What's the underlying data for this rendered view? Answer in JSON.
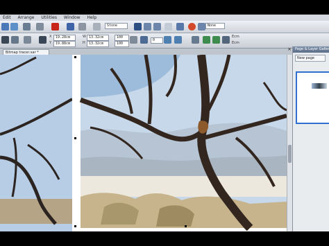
{
  "menu": [
    "Edit",
    "Arrange",
    "Utilities",
    "Window",
    "Help"
  ],
  "toolbar": {
    "zoom_value": "Stone",
    "style_value": "None",
    "x_value": "19.28cm",
    "y_value": "19.88cm",
    "w_value": "13.32cm",
    "h_value": "13.32cm",
    "scale_x": "100",
    "scale_y": "100",
    "rotate_value": "0",
    "text_opt_1": "Ecm",
    "text_opt_2": "Ecm",
    "x_label": "X",
    "y_label": "Y",
    "w_label": "W",
    "h_label": "H"
  },
  "document": {
    "tab_label": "Bitmap tracer.xar *"
  },
  "panel": {
    "title": "Page & Layer Gallery",
    "new_page_label": "New page",
    "close_glyph": "×"
  },
  "colors": {
    "accent": "#2f6fd0",
    "sky": "#b9cde4",
    "branch": "#3a2a22"
  }
}
